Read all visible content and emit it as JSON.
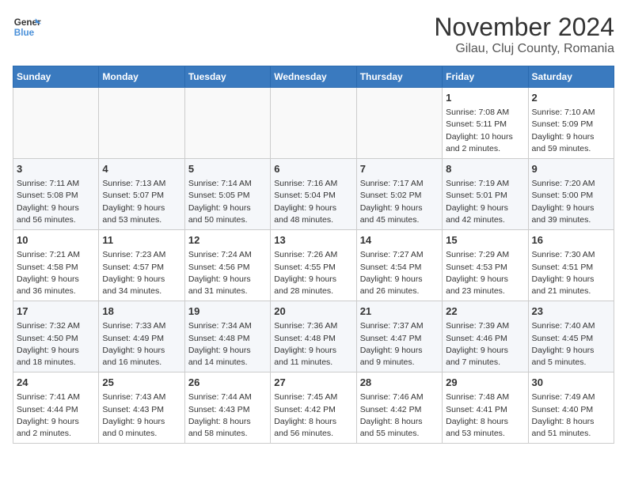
{
  "logo": {
    "line1": "General",
    "line2": "Blue"
  },
  "title": "November 2024",
  "subtitle": "Gilau, Cluj County, Romania",
  "days_of_week": [
    "Sunday",
    "Monday",
    "Tuesday",
    "Wednesday",
    "Thursday",
    "Friday",
    "Saturday"
  ],
  "weeks": [
    [
      {
        "day": "",
        "info": ""
      },
      {
        "day": "",
        "info": ""
      },
      {
        "day": "",
        "info": ""
      },
      {
        "day": "",
        "info": ""
      },
      {
        "day": "",
        "info": ""
      },
      {
        "day": "1",
        "info": "Sunrise: 7:08 AM\nSunset: 5:11 PM\nDaylight: 10 hours\nand 2 minutes."
      },
      {
        "day": "2",
        "info": "Sunrise: 7:10 AM\nSunset: 5:09 PM\nDaylight: 9 hours\nand 59 minutes."
      }
    ],
    [
      {
        "day": "3",
        "info": "Sunrise: 7:11 AM\nSunset: 5:08 PM\nDaylight: 9 hours\nand 56 minutes."
      },
      {
        "day": "4",
        "info": "Sunrise: 7:13 AM\nSunset: 5:07 PM\nDaylight: 9 hours\nand 53 minutes."
      },
      {
        "day": "5",
        "info": "Sunrise: 7:14 AM\nSunset: 5:05 PM\nDaylight: 9 hours\nand 50 minutes."
      },
      {
        "day": "6",
        "info": "Sunrise: 7:16 AM\nSunset: 5:04 PM\nDaylight: 9 hours\nand 48 minutes."
      },
      {
        "day": "7",
        "info": "Sunrise: 7:17 AM\nSunset: 5:02 PM\nDaylight: 9 hours\nand 45 minutes."
      },
      {
        "day": "8",
        "info": "Sunrise: 7:19 AM\nSunset: 5:01 PM\nDaylight: 9 hours\nand 42 minutes."
      },
      {
        "day": "9",
        "info": "Sunrise: 7:20 AM\nSunset: 5:00 PM\nDaylight: 9 hours\nand 39 minutes."
      }
    ],
    [
      {
        "day": "10",
        "info": "Sunrise: 7:21 AM\nSunset: 4:58 PM\nDaylight: 9 hours\nand 36 minutes."
      },
      {
        "day": "11",
        "info": "Sunrise: 7:23 AM\nSunset: 4:57 PM\nDaylight: 9 hours\nand 34 minutes."
      },
      {
        "day": "12",
        "info": "Sunrise: 7:24 AM\nSunset: 4:56 PM\nDaylight: 9 hours\nand 31 minutes."
      },
      {
        "day": "13",
        "info": "Sunrise: 7:26 AM\nSunset: 4:55 PM\nDaylight: 9 hours\nand 28 minutes."
      },
      {
        "day": "14",
        "info": "Sunrise: 7:27 AM\nSunset: 4:54 PM\nDaylight: 9 hours\nand 26 minutes."
      },
      {
        "day": "15",
        "info": "Sunrise: 7:29 AM\nSunset: 4:53 PM\nDaylight: 9 hours\nand 23 minutes."
      },
      {
        "day": "16",
        "info": "Sunrise: 7:30 AM\nSunset: 4:51 PM\nDaylight: 9 hours\nand 21 minutes."
      }
    ],
    [
      {
        "day": "17",
        "info": "Sunrise: 7:32 AM\nSunset: 4:50 PM\nDaylight: 9 hours\nand 18 minutes."
      },
      {
        "day": "18",
        "info": "Sunrise: 7:33 AM\nSunset: 4:49 PM\nDaylight: 9 hours\nand 16 minutes."
      },
      {
        "day": "19",
        "info": "Sunrise: 7:34 AM\nSunset: 4:48 PM\nDaylight: 9 hours\nand 14 minutes."
      },
      {
        "day": "20",
        "info": "Sunrise: 7:36 AM\nSunset: 4:48 PM\nDaylight: 9 hours\nand 11 minutes."
      },
      {
        "day": "21",
        "info": "Sunrise: 7:37 AM\nSunset: 4:47 PM\nDaylight: 9 hours\nand 9 minutes."
      },
      {
        "day": "22",
        "info": "Sunrise: 7:39 AM\nSunset: 4:46 PM\nDaylight: 9 hours\nand 7 minutes."
      },
      {
        "day": "23",
        "info": "Sunrise: 7:40 AM\nSunset: 4:45 PM\nDaylight: 9 hours\nand 5 minutes."
      }
    ],
    [
      {
        "day": "24",
        "info": "Sunrise: 7:41 AM\nSunset: 4:44 PM\nDaylight: 9 hours\nand 2 minutes."
      },
      {
        "day": "25",
        "info": "Sunrise: 7:43 AM\nSunset: 4:43 PM\nDaylight: 9 hours\nand 0 minutes."
      },
      {
        "day": "26",
        "info": "Sunrise: 7:44 AM\nSunset: 4:43 PM\nDaylight: 8 hours\nand 58 minutes."
      },
      {
        "day": "27",
        "info": "Sunrise: 7:45 AM\nSunset: 4:42 PM\nDaylight: 8 hours\nand 56 minutes."
      },
      {
        "day": "28",
        "info": "Sunrise: 7:46 AM\nSunset: 4:42 PM\nDaylight: 8 hours\nand 55 minutes."
      },
      {
        "day": "29",
        "info": "Sunrise: 7:48 AM\nSunset: 4:41 PM\nDaylight: 8 hours\nand 53 minutes."
      },
      {
        "day": "30",
        "info": "Sunrise: 7:49 AM\nSunset: 4:40 PM\nDaylight: 8 hours\nand 51 minutes."
      }
    ]
  ]
}
